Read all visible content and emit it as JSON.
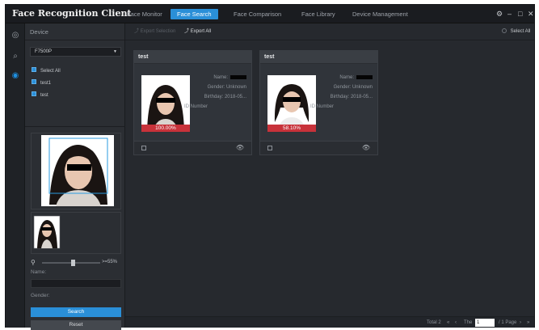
{
  "app": {
    "title": "Face Recognition Client"
  },
  "tabs": [
    {
      "label": "Face Monitor",
      "active": false
    },
    {
      "label": "Face Search",
      "active": true
    },
    {
      "label": "Face Comparison",
      "active": false
    },
    {
      "label": "Face Library",
      "active": false
    },
    {
      "label": "Device Management",
      "active": false
    }
  ],
  "window_controls": {
    "settings": "⚙",
    "minimize": "–",
    "maximize": "□",
    "close": "✕"
  },
  "rail": [
    {
      "icon": "face-capture-icon",
      "glyph": "◎"
    },
    {
      "icon": "search-list-icon",
      "glyph": "⌕"
    },
    {
      "icon": "face-search-icon",
      "glyph": "◉",
      "active": true
    }
  ],
  "sidebar": {
    "heading": "Device",
    "device": "F7500P",
    "tree": [
      {
        "label": "Select All",
        "checked": true
      },
      {
        "label": "test1",
        "checked": true
      },
      {
        "label": "test",
        "checked": true
      }
    ],
    "similarity": ">=55%",
    "name_label": "Name:",
    "name_value": "",
    "gender_label": "Gender:",
    "search_button": "Search",
    "reset_button": "Reset"
  },
  "toolbar": {
    "export_selection": "Export Selection",
    "export_all": "Export All",
    "select_all": "Select All"
  },
  "cards": [
    {
      "title": "test",
      "name_label": "Name:",
      "gender": "Gender: Unknown",
      "birthday": "Birthday: 2018-05...",
      "id_number": "ID Number",
      "score": "100.00%"
    },
    {
      "title": "test",
      "name_label": "Name:",
      "gender": "Gender: Unknown",
      "birthday": "Birthday: 2018-05...",
      "id_number": "ID Number",
      "score": "58.10%"
    }
  ],
  "pagination": {
    "total": "Total 2",
    "first": "«",
    "prev": "‹",
    "the": "The",
    "current_page": "1",
    "of_pages": "/ 1 Page",
    "next": "›",
    "last": "»"
  },
  "colors": {
    "accent": "#2a8fd8",
    "score_bar": "#c8323a",
    "background": "#26292e"
  }
}
